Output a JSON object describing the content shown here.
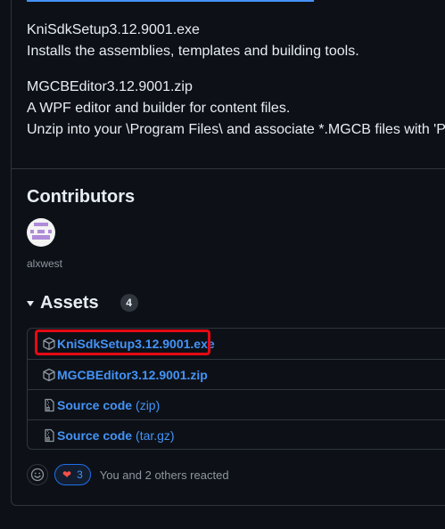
{
  "release": {
    "body_lines": [
      "KniSdkSetup3.12.9001.exe",
      "Installs the assemblies, templates and building tools.",
      "MGCBEditor3.12.9001.zip",
      "A WPF editor and builder for content files.",
      "Unzip into your \\Program Files\\ and associate *.MGCB files with 'Pr"
    ]
  },
  "contributors": {
    "heading": "Contributors",
    "users": [
      {
        "name": "alxwest"
      }
    ]
  },
  "assets": {
    "heading": "Assets",
    "count": "4",
    "items": [
      {
        "label": "KniSdkSetup3.12.9001.exe",
        "suffix": "",
        "icon": "package-icon",
        "highlighted": true
      },
      {
        "label": "MGCBEditor3.12.9001.zip",
        "suffix": "",
        "icon": "package-icon",
        "highlighted": false
      },
      {
        "label": "Source code",
        "suffix": "(zip)",
        "icon": "file-zip-icon",
        "highlighted": false
      },
      {
        "label": "Source code",
        "suffix": "(tar.gz)",
        "icon": "file-zip-icon",
        "highlighted": false
      }
    ]
  },
  "reactions": {
    "heart_count": "3",
    "summary": "You and 2 others reacted"
  },
  "colors": {
    "background": "#0d1117",
    "link": "#4493f8",
    "border": "#30363d",
    "highlight": "#e50914",
    "heart": "#f85149"
  }
}
